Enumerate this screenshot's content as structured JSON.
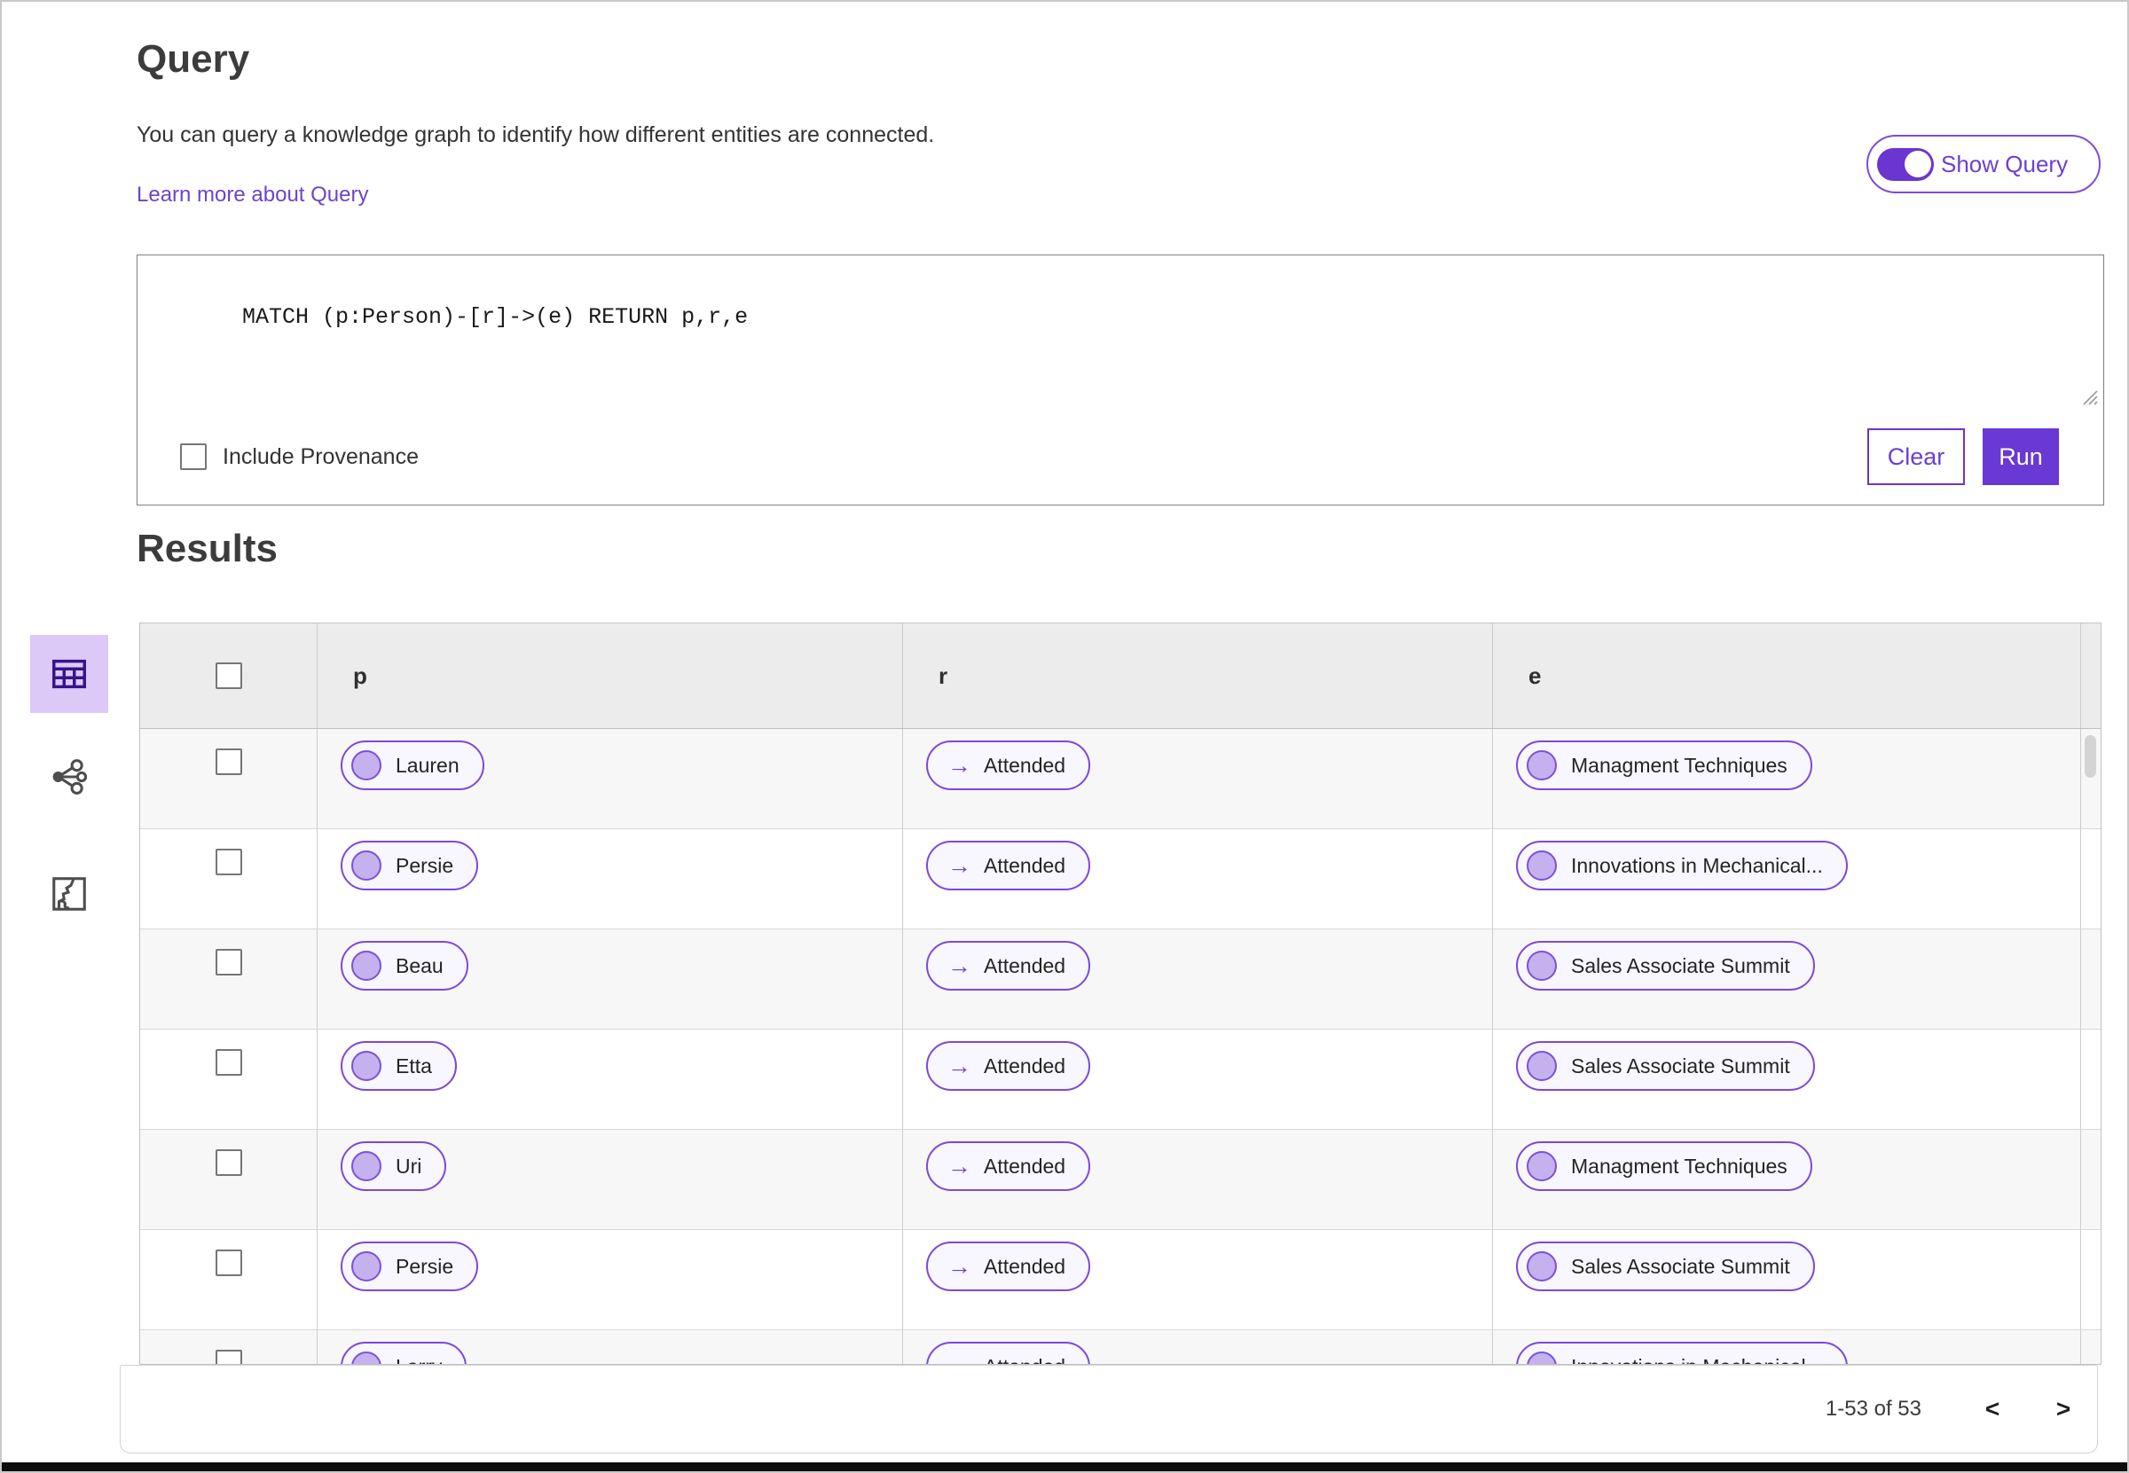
{
  "page": {
    "title": "Query",
    "description": "You can query a knowledge graph to identify how different entities are connected.",
    "learn_more": "Learn more about Query",
    "show_query_label": "Show Query",
    "query_text": "MATCH (p:Person)-[r]->(e) RETURN p,r,e",
    "include_provenance_label": "Include Provenance",
    "clear_label": "Clear",
    "run_label": "Run",
    "results_title": "Results"
  },
  "view_switcher": [
    {
      "name": "table-view",
      "icon": "table-icon",
      "active": true
    },
    {
      "name": "graph-view",
      "icon": "network-icon",
      "active": false
    },
    {
      "name": "map-view",
      "icon": "map-icon",
      "active": false
    }
  ],
  "results_table": {
    "columns": [
      "p",
      "r",
      "e"
    ],
    "rows": [
      {
        "p": "Lauren",
        "r": "Attended",
        "e": "Managment Techniques"
      },
      {
        "p": "Persie",
        "r": "Attended",
        "e": "Innovations in Mechanical..."
      },
      {
        "p": "Beau",
        "r": "Attended",
        "e": "Sales Associate Summit"
      },
      {
        "p": "Etta",
        "r": "Attended",
        "e": "Sales Associate Summit"
      },
      {
        "p": "Uri",
        "r": "Attended",
        "e": "Managment Techniques"
      },
      {
        "p": "Persie",
        "r": "Attended",
        "e": "Sales Associate Summit"
      },
      {
        "p": "Larry",
        "r": "Attended",
        "e": "Innovations in Mechanical..."
      }
    ]
  },
  "pagination": {
    "range_label": "1-53 of 53",
    "prev_icon": "<",
    "next_icon": ">"
  },
  "colors": {
    "accent": "#6a38d4",
    "chip_border": "#7a4ad8",
    "chip_bg": "#f8f6fe",
    "chip_dot": "#c5b1ee",
    "active_tile_bg": "#dcc9f8",
    "table_header_bg": "#ececec",
    "row_stripe": "#f7f7f7",
    "link": "#6b46c8"
  }
}
